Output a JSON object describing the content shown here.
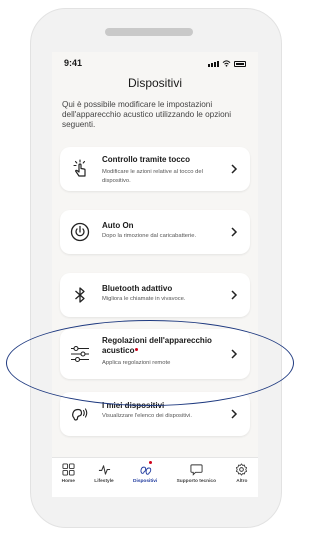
{
  "status_bar": {
    "time": "9:41"
  },
  "header": {
    "title": "Dispositivi"
  },
  "intro_text": "Qui è possibile modificare le impostazioni dell'apparecchio acustico utilizzando le opzioni seguenti.",
  "cards": [
    {
      "title": "Controllo tramite tocco",
      "subtitle": "Modificare le azioni relative al tocco del dispositivo.",
      "icon": "touch-icon"
    },
    {
      "title": "Auto On",
      "subtitle": "Dopo la rimozione dal caricabatterie.",
      "icon": "power-icon"
    },
    {
      "title": "Bluetooth adattivo",
      "subtitle": "Migliora le chiamate in vivavoce.",
      "icon": "bluetooth-icon"
    },
    {
      "title": "Regolazioni dell'apparecchio acustico",
      "subtitle": "Applica regolazioni remote",
      "icon": "sliders-icon",
      "has_notification": true
    },
    {
      "title": "I miei dispositivi",
      "subtitle": "Visualizzare l'elenco dei dispositivi.",
      "icon": "hearing-aid-icon"
    }
  ],
  "tabs": [
    {
      "label": "Home",
      "icon": "grid-icon",
      "active": false
    },
    {
      "label": "Lifestyle",
      "icon": "pulse-icon",
      "active": false
    },
    {
      "label": "Dispositivi",
      "icon": "hearing-aids-icon",
      "active": true,
      "has_notification": true
    },
    {
      "label": "Supporto tecnico",
      "icon": "chat-icon",
      "active": false
    },
    {
      "label": "Altro",
      "icon": "gear-icon",
      "active": false
    }
  ],
  "colors": {
    "accent": "#1f3a9e",
    "notification": "#d0021b",
    "annotation": "#1f3a80"
  }
}
